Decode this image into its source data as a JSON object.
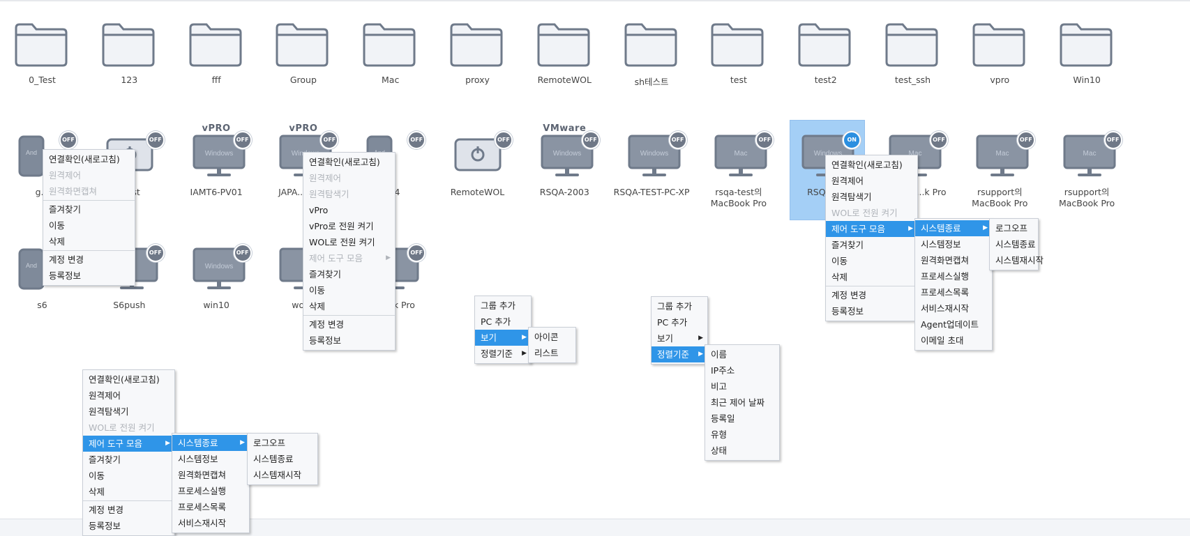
{
  "folders": [
    "0_Test",
    "123",
    "fff",
    "Group",
    "Mac",
    "proxy",
    "RemoteWOL",
    "sh테스트",
    "test",
    "test2",
    "test_ssh",
    "vpro",
    "Win10"
  ],
  "pcs_row1": [
    {
      "label": "g...",
      "os": "Android",
      "status": "OFF",
      "brand": ""
    },
    {
      "label": "...est",
      "os": "",
      "status": "OFF",
      "brand": ""
    },
    {
      "label": "IAMT6-PV01",
      "os": "Windows",
      "status": "OFF",
      "brand": "vPRO"
    },
    {
      "label": "JAPA... RS...",
      "os": "Windows",
      "status": "OFF",
      "brand": "vPRO"
    },
    {
      "label": "...e4",
      "os": "Android",
      "status": "OFF",
      "brand": ""
    },
    {
      "label": "RemoteWOL",
      "os": "",
      "status": "OFF",
      "brand": ""
    },
    {
      "label": "RSQA-2003",
      "os": "Windows",
      "status": "OFF",
      "brand": "VMware"
    },
    {
      "label": "RSQA-TEST-PC-XP",
      "os": "Windows",
      "status": "OFF",
      "brand": ""
    },
    {
      "label": "rsqa-test의 MacBook Pro",
      "os": "Mac",
      "status": "OFF",
      "brand": ""
    },
    {
      "label": "RSQA_...",
      "os": "Windows",
      "status": "ON",
      "brand": ""
    },
    {
      "label": "...port의 ...k Pro",
      "os": "Mac",
      "status": "OFF",
      "brand": ""
    },
    {
      "label": "rsupport의 MacBook Pro",
      "os": "Mac",
      "status": "OFF",
      "brand": ""
    },
    {
      "label": "rsupport의 MacBook Pro",
      "os": "Mac",
      "status": "OFF",
      "brand": ""
    }
  ],
  "pcs_row2": [
    {
      "label": "s6",
      "os": "Android",
      "status": "OFF"
    },
    {
      "label": "S6push",
      "os": "",
      "status": "OFF"
    },
    {
      "label": "win10",
      "os": "Windows",
      "status": "OFF"
    },
    {
      "label": "wol...",
      "os": "",
      "status": "OFF"
    },
    {
      "label": "...의 ...k Pro",
      "os": "",
      "status": "OFF"
    }
  ],
  "menu_a": [
    "연결확인(새로고침)",
    "원격제어",
    "원격화면캡쳐",
    "즐겨찾기",
    "이동",
    "삭제",
    "계정 변경",
    "등록정보"
  ],
  "menu_b": [
    "연결확인(새로고침)",
    "원격제어",
    "원격탐색기",
    "vPro",
    "vPro로 전원 켜기",
    "WOL로 전원 켜기",
    "제어 도구 모음",
    "즐겨찾기",
    "이동",
    "삭제",
    "계정 변경",
    "등록정보"
  ],
  "menu_c": [
    "그룹 추가",
    "PC 추가",
    "보기",
    "정렬기준"
  ],
  "menu_c_sub": [
    "아이콘",
    "리스트"
  ],
  "menu_d": [
    "그룹 추가",
    "PC 추가",
    "보기",
    "정렬기준"
  ],
  "menu_d_sub": [
    "이름",
    "IP주소",
    "비고",
    "최근 제어 날짜",
    "등록일",
    "유형",
    "상태"
  ],
  "menu_e": [
    "연결확인(새로고침)",
    "원격제어",
    "원격탐색기",
    "WOL로 전원 켜기",
    "제어 도구 모음",
    "즐겨찾기",
    "이동",
    "삭제",
    "계정 변경",
    "등록정보"
  ],
  "menu_e_sub": [
    "시스템종료",
    "시스템정보",
    "원격화면캡쳐",
    "프로세스실행",
    "프로세스목록",
    "서비스재시작",
    "Agent업데이트",
    "이메일 초대"
  ],
  "menu_e_sub2": [
    "로그오프",
    "시스템종료",
    "시스템재시작"
  ],
  "menu_f": [
    "연결확인(새로고침)",
    "원격제어",
    "원격탐색기",
    "WOL로 전원 켜기",
    "제어 도구 모음",
    "즐겨찾기",
    "이동",
    "삭제",
    "계정 변경",
    "등록정보"
  ],
  "menu_f_sub": [
    "시스템종료",
    "시스템정보",
    "원격화면캡쳐",
    "프로세스실행",
    "프로세스목록",
    "서비스재시작"
  ],
  "menu_f_sub2": [
    "로그오프",
    "시스템종료",
    "시스템재시작"
  ],
  "colors": {
    "accent": "#2f95e8",
    "icon": "#6f7a8a",
    "selection": "#5aa8f0"
  }
}
